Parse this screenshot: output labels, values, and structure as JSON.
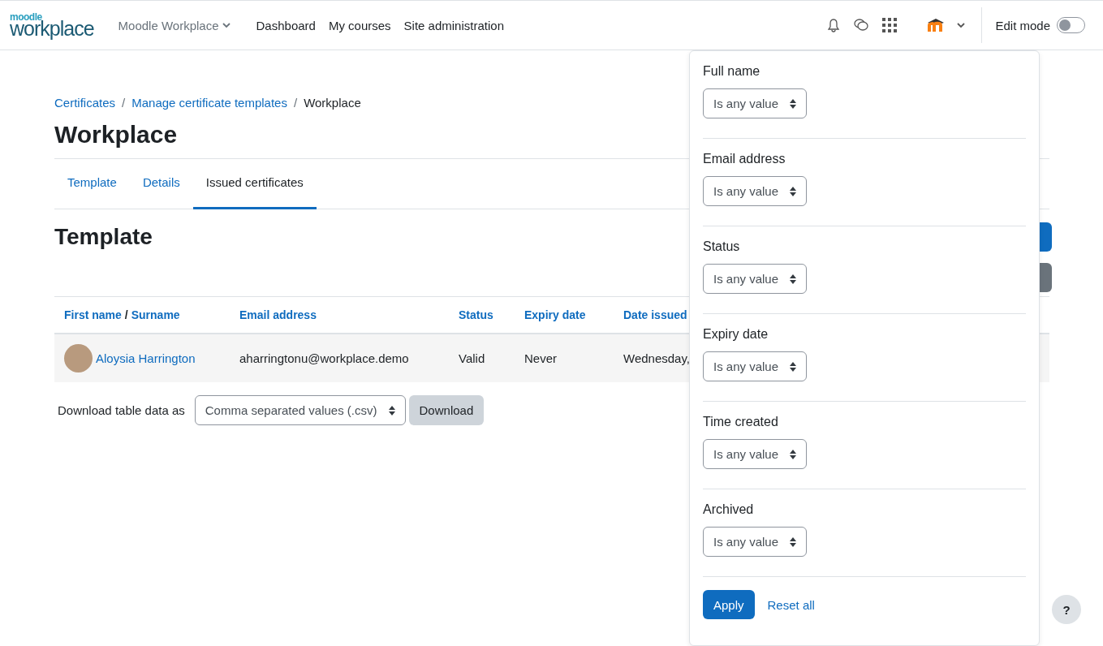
{
  "navbar": {
    "logo_top": "moodle",
    "logo_main": "workplace",
    "tenant": "Moodle Workplace",
    "links": [
      {
        "label": "Dashboard"
      },
      {
        "label": "My courses"
      },
      {
        "label": "Site administration"
      }
    ],
    "edit_mode": {
      "label": "Edit mode",
      "on": false
    }
  },
  "breadcrumbs": [
    {
      "label": "Certificates",
      "link": true
    },
    {
      "label": "Manage certificate templates",
      "link": true
    },
    {
      "label": "Workplace",
      "link": false
    }
  ],
  "breadcrumb_separator": "/",
  "page_title": "Workplace",
  "tabs": [
    {
      "label": "Template",
      "selected": false
    },
    {
      "label": "Details",
      "selected": false
    },
    {
      "label": "Issued certificates",
      "selected": true
    }
  ],
  "section_title": "Template",
  "table": {
    "columns": [
      {
        "parts": [
          "First name",
          "Surname"
        ],
        "separator": "/"
      },
      {
        "parts": [
          "Email address"
        ]
      },
      {
        "parts": [
          "Status"
        ]
      },
      {
        "parts": [
          "Expiry date"
        ]
      },
      {
        "parts": [
          "Date issued"
        ]
      }
    ],
    "rows": [
      {
        "name": "Aloysia Harrington",
        "email": "aharringtonu@workplace.demo",
        "status": "Valid",
        "expiry": "Never",
        "issued": "Wednesday,"
      }
    ]
  },
  "download": {
    "label": "Download table data as",
    "format": "Comma separated values (.csv)",
    "button": "Download"
  },
  "filters": [
    {
      "label": "Full name",
      "value": "Is any value"
    },
    {
      "label": "Email address",
      "value": "Is any value"
    },
    {
      "label": "Status",
      "value": "Is any value"
    },
    {
      "label": "Expiry date",
      "value": "Is any value"
    },
    {
      "label": "Time created",
      "value": "Is any value"
    },
    {
      "label": "Archived",
      "value": "Is any value"
    }
  ],
  "filter_actions": {
    "apply": "Apply",
    "reset": "Reset all"
  },
  "help_button": "?"
}
